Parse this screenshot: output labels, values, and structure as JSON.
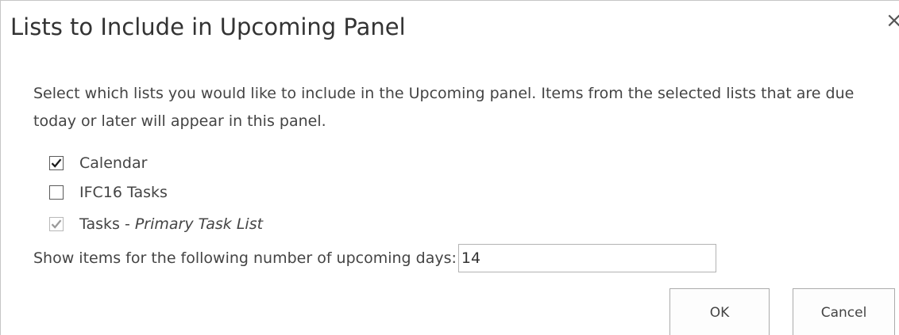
{
  "dialog": {
    "title": "Lists to Include in Upcoming Panel",
    "close_glyph": "×",
    "description": "Select which lists you would like to include in the Upcoming panel. Items from the selected lists that are due today or later will appear in this panel.",
    "options": [
      {
        "label": "Calendar",
        "checked": true,
        "disabled": false
      },
      {
        "label": "IFC16 Tasks",
        "checked": false,
        "disabled": false
      },
      {
        "label": "Tasks",
        "separator": " - ",
        "sublabel": "Primary Task List",
        "checked": true,
        "disabled": true
      }
    ],
    "days_label": "Show items for the following number of upcoming days:",
    "days_value": "14",
    "ok_label": "OK",
    "cancel_label": "Cancel"
  }
}
